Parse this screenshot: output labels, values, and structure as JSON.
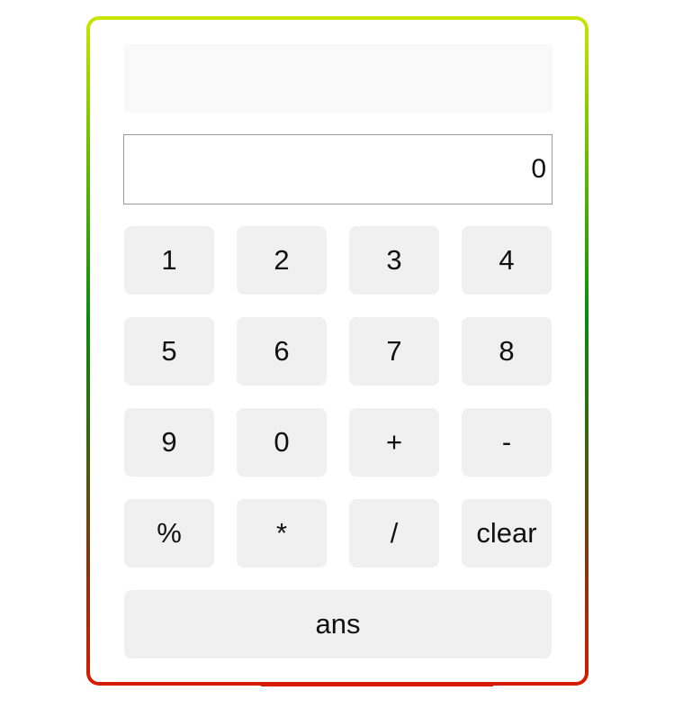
{
  "display": {
    "value": "0",
    "history": ""
  },
  "keys": {
    "k1": "1",
    "k2": "2",
    "k3": "3",
    "k4": "4",
    "k5": "5",
    "k6": "6",
    "k7": "7",
    "k8": "8",
    "k9": "9",
    "k0": "0",
    "plus": "+",
    "minus": "-",
    "percent": "%",
    "multiply": "*",
    "divide": "/",
    "clear": "clear",
    "ans": "ans"
  },
  "colors": {
    "border_top": "#c8e600",
    "border_middle": "#0a8a0f",
    "border_bottom": "#d61b00",
    "key_background": "#f0f0f0",
    "history_background": "#f9f9f9"
  }
}
